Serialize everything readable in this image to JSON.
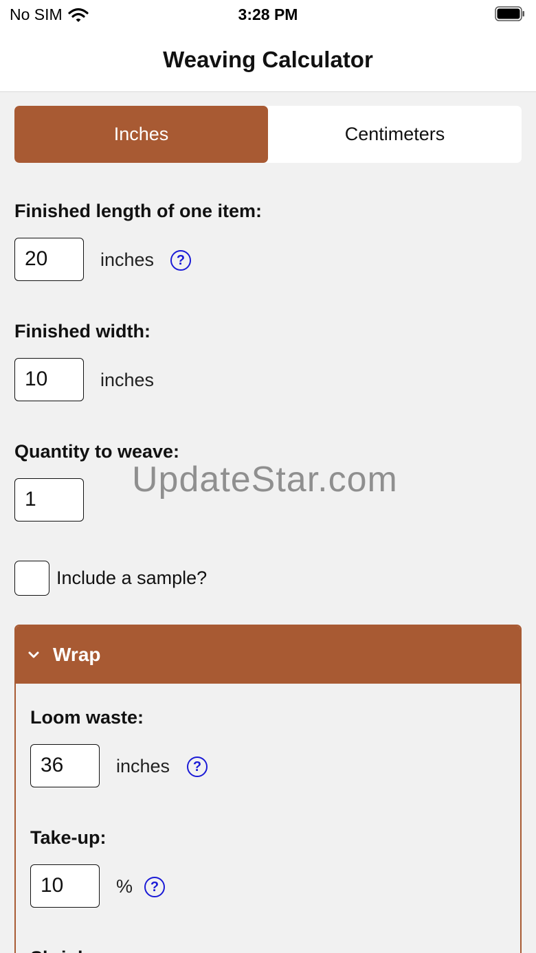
{
  "status_bar": {
    "carrier": "No SIM",
    "time": "3:28 PM"
  },
  "nav": {
    "title": "Weaving Calculator"
  },
  "units_segment": {
    "options": [
      "Inches",
      "Centimeters"
    ],
    "selected": "Inches"
  },
  "finished_length": {
    "label": "Finished length of one item:",
    "value": "20",
    "unit": "inches",
    "help": "?"
  },
  "finished_width": {
    "label": "Finished width:",
    "value": "10",
    "unit": "inches"
  },
  "quantity": {
    "label": "Quantity to weave:",
    "value": "1"
  },
  "sample": {
    "label": "Include a sample?",
    "checked": false
  },
  "watermark": "UpdateStar.com",
  "wrap_panel": {
    "title": "Wrap",
    "expanded": true,
    "loom_waste": {
      "label": "Loom waste:",
      "value": "36",
      "unit": "inches",
      "help": "?"
    },
    "take_up": {
      "label": "Take-up:",
      "value": "10",
      "unit": "%",
      "help": "?"
    },
    "next_label_partial": "Shrinkage"
  },
  "colors": {
    "accent": "#a85a33",
    "help_blue": "#1a1ad6",
    "background": "#f1f1f1"
  },
  "icons": {
    "wifi": "wifi-icon",
    "battery": "battery-icon",
    "help": "help-icon",
    "chevron": "chevron-down-icon"
  }
}
